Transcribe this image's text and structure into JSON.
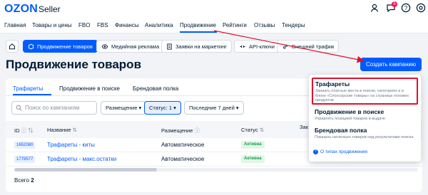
{
  "brand": {
    "logo": "OZON",
    "sub": "Seller"
  },
  "header_icons": [
    "user-icon",
    "chat-icon",
    "help-icon",
    "settings-icon"
  ],
  "notification_count": "5",
  "main_nav": [
    "Главная",
    "Товары и цены",
    "FBO",
    "FBS",
    "Финансы",
    "Аналитика",
    "Продвижение",
    "Рейтинги",
    "Отзывы",
    "Тендеры"
  ],
  "sub_tabs": [
    {
      "label": "Продвижение товаров",
      "icon": "box-icon"
    },
    {
      "label": "Медийная реклама",
      "icon": "eye-icon"
    },
    {
      "label": "Заявки на маркетинг",
      "icon": "document-icon"
    },
    {
      "label": "API-ключи",
      "icon": "api-icon"
    },
    {
      "label": "Внешний трафик",
      "icon": "link-icon"
    }
  ],
  "page_title": "Продвижение товаров",
  "create_button": "Создать кампанию",
  "content_tabs": [
    "Трафареты",
    "Продвижение в поиске",
    "Брендовая полка"
  ],
  "search_placeholder": "Поиск по кампаниям",
  "filters": {
    "placement": "Размещение",
    "status": "Статус: 1",
    "period": "Последние 7 дней"
  },
  "table": {
    "headers": {
      "id": "ID",
      "name": "Название",
      "placement": "Размещение",
      "status": "Статус",
      "extra": "Зак"
    },
    "rows": [
      {
        "id": "1652080",
        "name": "Трафареты - киты",
        "placement": "Автоматическое",
        "status": "Активна"
      },
      {
        "id": "1778577",
        "name": "Трафареты - макс.остатки",
        "placement": "Автоматическое",
        "status": "Активна"
      }
    ],
    "total_label": "Всего",
    "total_value": "2"
  },
  "dropdown": {
    "items": [
      {
        "title": "Трафареты",
        "desc": "Заниать платные места в поиске, категориях и в блоке «Спонсорские товары» на странице похожих продуктов"
      },
      {
        "title": "Продвижение в поиске",
        "desc": "Управлять позицией товаров в выдаче"
      },
      {
        "title": "Брендовая полка",
        "desc": "Показать несколько товаров над результатами поиска"
      }
    ],
    "footer_link": "О типах продвижения"
  },
  "colors": {
    "accent": "#005bff",
    "highlight": "#e30f2b",
    "status_green": "#10a14f"
  }
}
